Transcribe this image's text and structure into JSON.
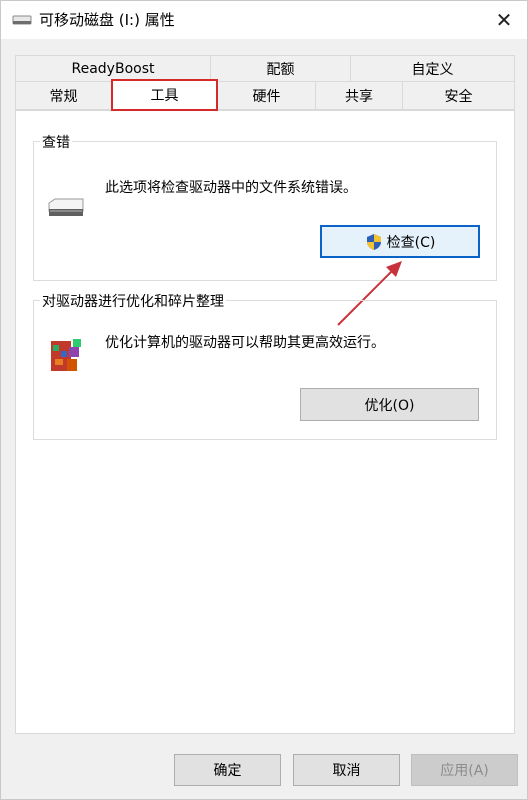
{
  "window": {
    "title": "可移动磁盘 (I:) 属性",
    "close_glyph": "✕"
  },
  "tabs": {
    "row1": [
      {
        "label": "ReadyBoost"
      },
      {
        "label": "配额"
      },
      {
        "label": "自定义"
      }
    ],
    "row2": [
      {
        "label": "常规"
      },
      {
        "label": "工具",
        "active": true
      },
      {
        "label": "硬件"
      },
      {
        "label": "共享"
      },
      {
        "label": "安全"
      }
    ]
  },
  "error_check": {
    "title": "查错",
    "description": "此选项将检查驱动器中的文件系统错误。",
    "button_label": "检查(C)"
  },
  "optimize": {
    "title": "对驱动器进行优化和碎片整理",
    "description": "优化计算机的驱动器可以帮助其更高效运行。",
    "button_label": "优化(O)"
  },
  "footer": {
    "ok_label": "确定",
    "cancel_label": "取消",
    "apply_label": "应用(A)"
  },
  "colors": {
    "highlight_red": "#d62a2a",
    "focus_blue": "#0a64c8"
  }
}
